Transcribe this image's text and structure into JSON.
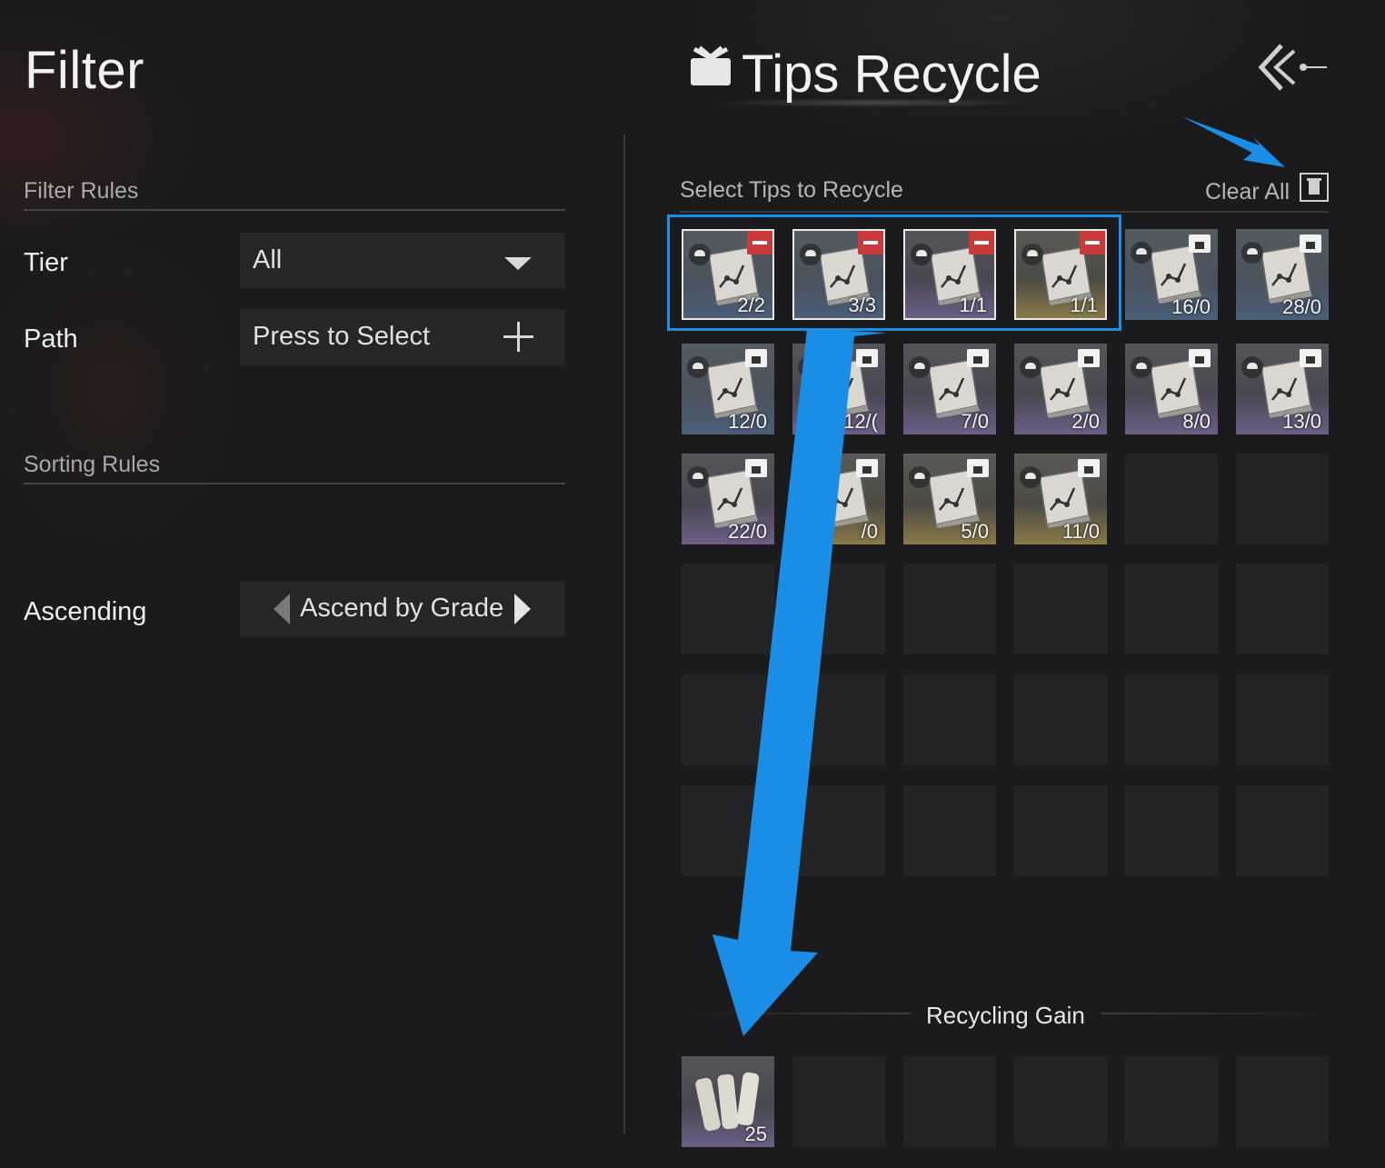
{
  "filter": {
    "title": "Filter",
    "filter_rules_label": "Filter Rules",
    "tier_label": "Tier",
    "tier_value": "All",
    "path_label": "Path",
    "path_value": "Press to Select",
    "sorting_rules_label": "Sorting Rules",
    "ascending_label": "Ascending",
    "sort_value": "Ascend by Grade"
  },
  "recycle": {
    "title": "Tips Recycle",
    "select_label": "Select Tips to Recycle",
    "clear_all_label": "Clear All",
    "tips": [
      {
        "count": "2/2",
        "selected": true,
        "tone": "blue"
      },
      {
        "count": "3/3",
        "selected": true,
        "tone": "blue"
      },
      {
        "count": "1/1",
        "selected": true,
        "tone": "purple"
      },
      {
        "count": "1/1",
        "selected": true,
        "tone": "gold"
      },
      {
        "count": "16/0",
        "selected": false,
        "tone": "blue"
      },
      {
        "count": "28/0",
        "selected": false,
        "tone": "blue"
      },
      {
        "count": "12/0",
        "selected": false,
        "tone": "blue"
      },
      {
        "count": "12/(",
        "selected": false,
        "tone": "purple"
      },
      {
        "count": "7/0",
        "selected": false,
        "tone": "purple"
      },
      {
        "count": "2/0",
        "selected": false,
        "tone": "purple"
      },
      {
        "count": "8/0",
        "selected": false,
        "tone": "purple"
      },
      {
        "count": "13/0",
        "selected": false,
        "tone": "purple"
      },
      {
        "count": "22/0",
        "selected": false,
        "tone": "purple"
      },
      {
        "count": "/0",
        "selected": false,
        "tone": "gold"
      },
      {
        "count": "5/0",
        "selected": false,
        "tone": "gold"
      },
      {
        "count": "11/0",
        "selected": false,
        "tone": "gold"
      }
    ],
    "gain_title": "Recycling Gain",
    "gain_items": [
      {
        "count": "25",
        "icon": "paper-scroll-icon"
      }
    ]
  },
  "colors": {
    "annotation_blue": "#1a8ee6",
    "remove_red": "#c93a3a",
    "background": "#1b1b1d"
  }
}
